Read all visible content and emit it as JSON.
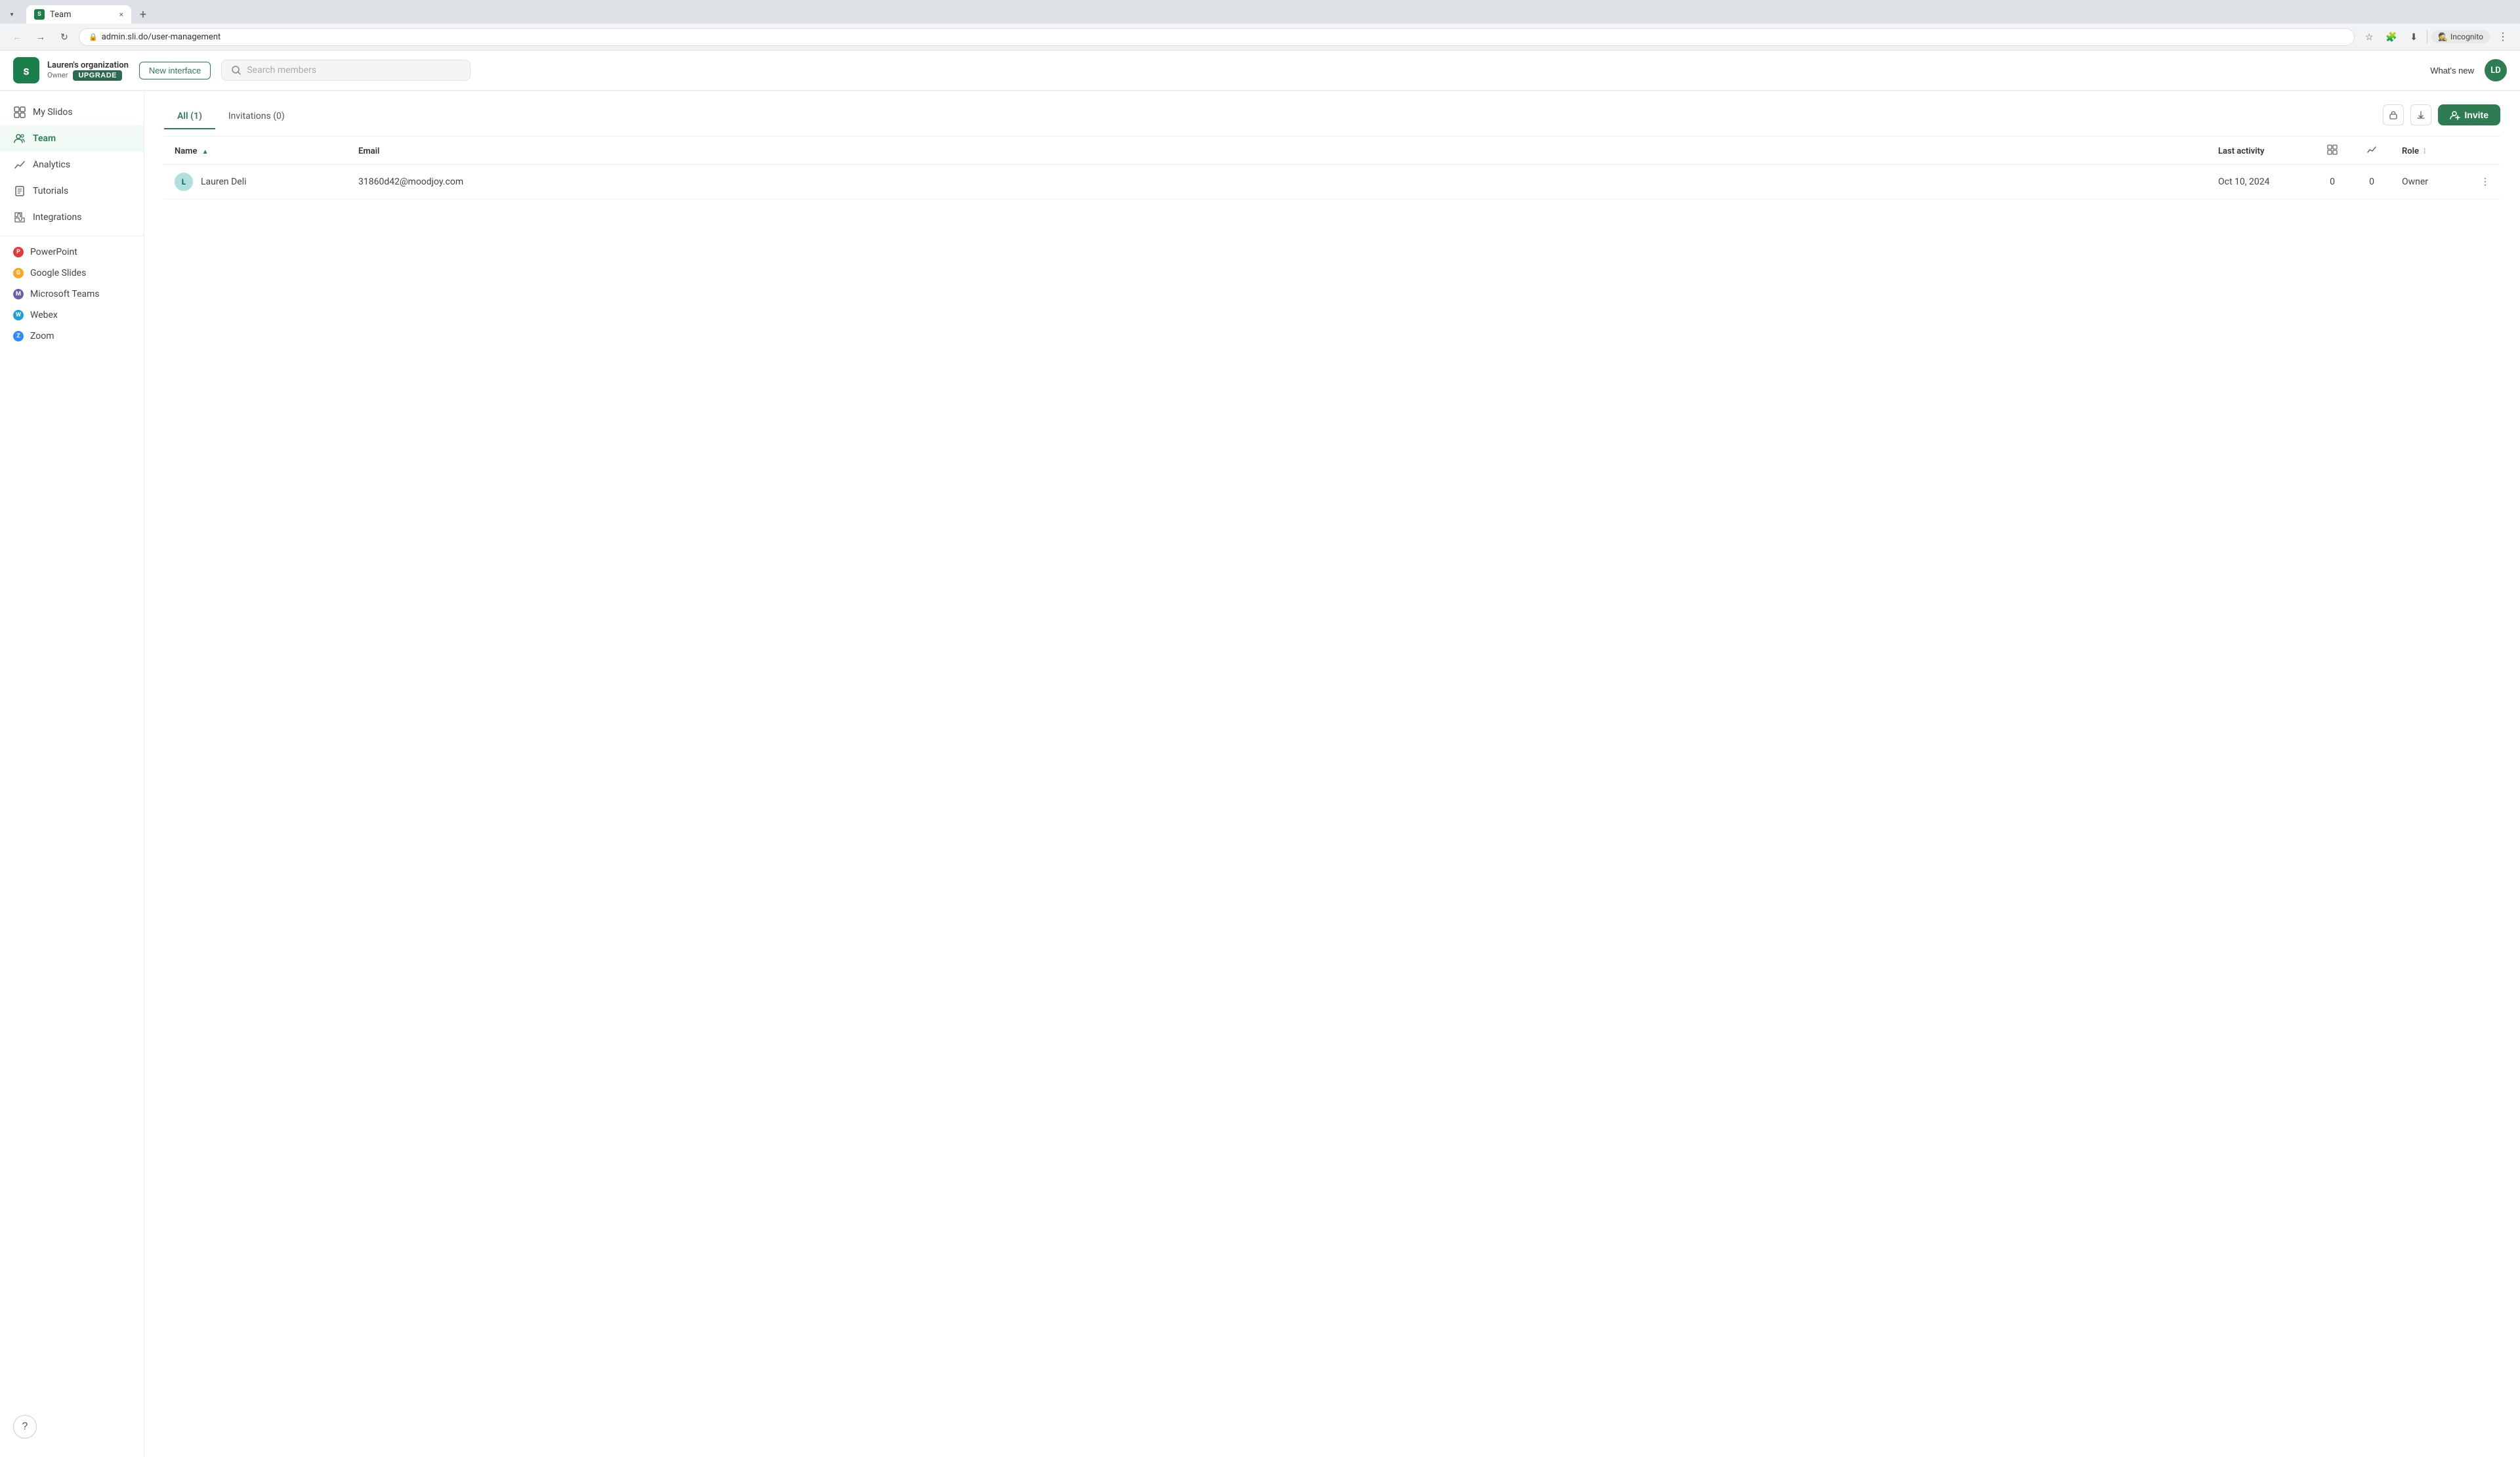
{
  "browser": {
    "tab_favicon": "S",
    "tab_title": "Team",
    "tab_close": "×",
    "tab_new": "+",
    "url": "admin.sli.do/user-management",
    "back_disabled": false,
    "forward_disabled": true,
    "incognito_label": "Incognito",
    "more_label": "⋮"
  },
  "header": {
    "org_name": "Lauren's organization",
    "owner_label": "Owner",
    "upgrade_label": "UPGRADE",
    "new_interface_label": "New interface",
    "search_placeholder": "Search members",
    "whats_new_label": "What's new",
    "avatar_initials": "LD"
  },
  "sidebar": {
    "items": [
      {
        "id": "my-slidos",
        "label": "My Slidos",
        "icon": "grid"
      },
      {
        "id": "team",
        "label": "Team",
        "icon": "users",
        "active": true
      },
      {
        "id": "analytics",
        "label": "Analytics",
        "icon": "chart"
      },
      {
        "id": "tutorials",
        "label": "Tutorials",
        "icon": "book"
      },
      {
        "id": "integrations",
        "label": "Integrations",
        "icon": "puzzle"
      }
    ],
    "integrations": [
      {
        "id": "powerpoint",
        "label": "PowerPoint",
        "color": "#e53935"
      },
      {
        "id": "google-slides",
        "label": "Google Slides",
        "color": "#f9a825"
      },
      {
        "id": "microsoft-teams",
        "label": "Microsoft Teams",
        "color": "#6264a7"
      },
      {
        "id": "webex",
        "label": "Webex",
        "color": "#1565c0"
      },
      {
        "id": "zoom",
        "label": "Zoom",
        "color": "#2d8cff"
      }
    ],
    "help_label": "?"
  },
  "main": {
    "tabs": [
      {
        "id": "all",
        "label": "All (1)",
        "active": true
      },
      {
        "id": "invitations",
        "label": "Invitations (0)",
        "active": false
      }
    ],
    "invite_label": "Invite",
    "table": {
      "columns": [
        {
          "id": "name",
          "label": "Name",
          "sortable": true
        },
        {
          "id": "email",
          "label": "Email"
        },
        {
          "id": "last_activity",
          "label": "Last activity"
        },
        {
          "id": "slidos_col",
          "label": ""
        },
        {
          "id": "charts_col",
          "label": ""
        },
        {
          "id": "role",
          "label": "Role",
          "filterable": true
        }
      ],
      "rows": [
        {
          "avatar": "L",
          "avatar_color": "#b2dfdb",
          "avatar_text_color": "#00695c",
          "name": "Lauren Deli",
          "email": "31860d42@moodjoy.com",
          "last_activity": "Oct 10, 2024",
          "slidos_count": "0",
          "charts_count": "0",
          "role": "Owner"
        }
      ]
    }
  }
}
